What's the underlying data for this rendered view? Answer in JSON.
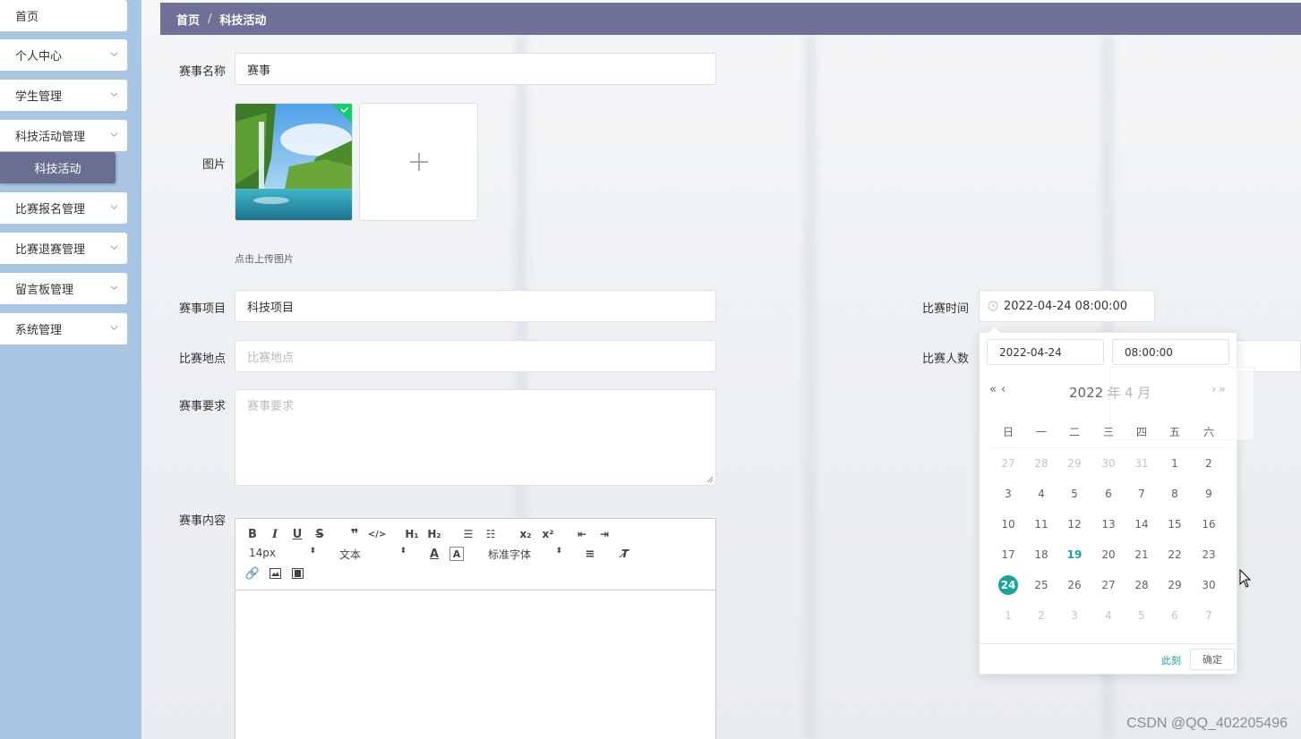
{
  "sidebar": {
    "items": [
      {
        "label": "首页"
      },
      {
        "label": "个人中心"
      },
      {
        "label": "学生管理"
      },
      {
        "label": "科技活动管理"
      },
      {
        "label": "比赛报名管理"
      },
      {
        "label": "比赛退赛管理"
      },
      {
        "label": "留言板管理"
      },
      {
        "label": "系统管理"
      }
    ],
    "active_sub": "科技活动"
  },
  "breadcrumb": {
    "home": "首页",
    "sep": "/",
    "current": "科技活动"
  },
  "form": {
    "name_label": "赛事名称",
    "name_value": "赛事",
    "image_label": "图片",
    "upload_hint": "点击上传图片",
    "project_label": "赛事项目",
    "project_value": "科技项目",
    "location_label": "比赛地点",
    "location_placeholder": "比赛地点",
    "requirement_label": "赛事要求",
    "requirement_placeholder": "赛事要求",
    "content_label": "赛事内容",
    "time_label": "比赛时间",
    "time_value": "2022-04-24 08:00:00",
    "count_label": "比赛人数"
  },
  "editor": {
    "font_size": "14px",
    "block_type": "文本",
    "font_family": "标准字体"
  },
  "datepicker": {
    "date_value": "2022-04-24",
    "time_value": "08:00:00",
    "year": "2022 年",
    "month": "4 月",
    "weekdays": [
      "日",
      "一",
      "二",
      "三",
      "四",
      "五",
      "六"
    ],
    "weeks": [
      [
        "27",
        "28",
        "29",
        "30",
        "31",
        "1",
        "2"
      ],
      [
        "3",
        "4",
        "5",
        "6",
        "7",
        "8",
        "9"
      ],
      [
        "10",
        "11",
        "12",
        "13",
        "14",
        "15",
        "16"
      ],
      [
        "17",
        "18",
        "19",
        "20",
        "21",
        "22",
        "23"
      ],
      [
        "24",
        "25",
        "26",
        "27",
        "28",
        "29",
        "30"
      ],
      [
        "1",
        "2",
        "3",
        "4",
        "5",
        "6",
        "7"
      ]
    ],
    "now_label": "此刻",
    "confirm_label": "确定"
  },
  "watermark": "CSDN @QQ_402205496",
  "colors": {
    "accent": "#16a596",
    "topbar": "#6e7096",
    "sidebar": "#a8c5e4"
  }
}
